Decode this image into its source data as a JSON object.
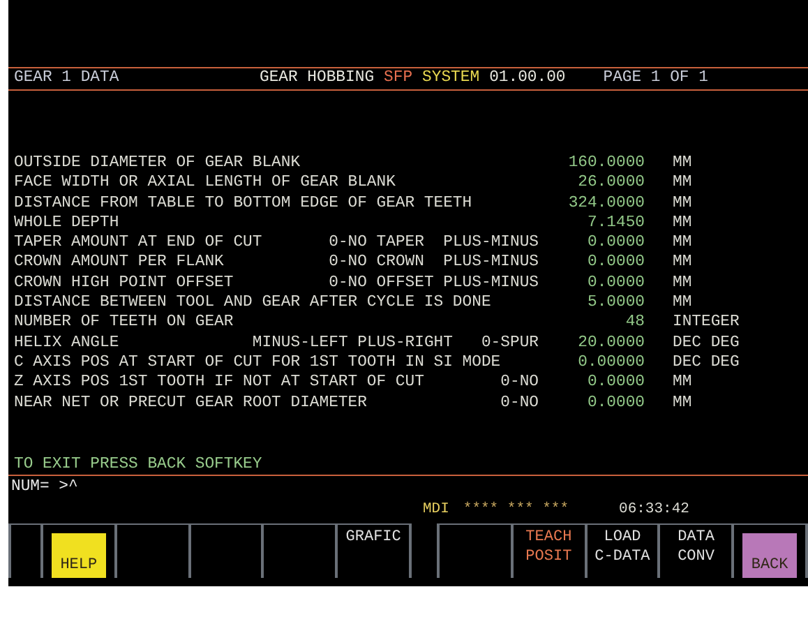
{
  "header": {
    "left": "GEAR 1 DATA",
    "system": [
      {
        "text": "GEAR HOBBING",
        "kind": "name"
      },
      {
        "text": "SFP",
        "kind": "brand"
      },
      {
        "text": "SYSTEM",
        "kind": "system"
      },
      {
        "text": "01.00.00",
        "kind": "version"
      }
    ],
    "page": "PAGE 1 OF 1"
  },
  "rows": [
    {
      "label": "OUTSIDE DIAMETER OF GEAR BLANK",
      "value": "160.0000",
      "unit": "MM"
    },
    {
      "label": "FACE WIDTH OR AXIAL LENGTH OF GEAR BLANK",
      "value": "26.0000",
      "unit": "MM"
    },
    {
      "label": "DISTANCE FROM TABLE TO BOTTOM EDGE OF GEAR TEETH",
      "value": "324.0000",
      "unit": "MM"
    },
    {
      "label": "WHOLE DEPTH",
      "value": "7.1450",
      "unit": "MM"
    },
    {
      "label": "TAPER AMOUNT AT END OF CUT",
      "option": "0-NO TAPER  PLUS-MINUS",
      "value": "0.0000",
      "unit": "MM"
    },
    {
      "label": "CROWN AMOUNT PER FLANK",
      "option": "0-NO CROWN  PLUS-MINUS",
      "value": "0.0000",
      "unit": "MM"
    },
    {
      "label": "CROWN HIGH POINT OFFSET",
      "option": "0-NO OFFSET PLUS-MINUS",
      "value": "0.0000",
      "unit": "MM"
    },
    {
      "label": "DISTANCE BETWEEN TOOL AND GEAR AFTER CYCLE IS DONE",
      "value": "5.0000",
      "unit": "MM"
    },
    {
      "label": "NUMBER OF TEETH ON GEAR",
      "value": "48",
      "unit": "INTEGER"
    },
    {
      "label": "HELIX ANGLE",
      "option": "MINUS-LEFT PLUS-RIGHT   0-SPUR",
      "value": "20.0000",
      "unit": "DEC DEG"
    },
    {
      "label": "C AXIS POS AT START OF CUT FOR 1ST TOOTH IN SI MODE",
      "value": "0.00000",
      "unit": "DEC DEG"
    },
    {
      "label": "Z AXIS POS 1ST TOOTH IF NOT AT START OF CUT",
      "option": "0-NO",
      "value": "0.0000",
      "unit": "MM"
    },
    {
      "label": "NEAR NET OR PRECUT GEAR ROOT DIAMETER",
      "option": "0-NO",
      "value": "0.0000",
      "unit": "MM"
    }
  ],
  "message": "TO EXIT PRESS BACK SOFTKEY",
  "input_line": "NUM= >^",
  "status": {
    "mode": "MDI",
    "indicators": "**** *** ***",
    "time": "06:33:42"
  },
  "softkeys": [
    {
      "kind": "blank"
    },
    {
      "kind": "filled",
      "color": "#f0e020",
      "lines": [
        "HELP"
      ]
    },
    {
      "kind": "blank"
    },
    {
      "kind": "blank"
    },
    {
      "kind": "blank"
    },
    {
      "kind": "plain",
      "lines": [
        "GRAFIC"
      ]
    },
    {
      "kind": "gap"
    },
    {
      "kind": "blank"
    },
    {
      "kind": "warning",
      "lines": [
        "TEACH",
        "POSIT"
      ]
    },
    {
      "kind": "plain",
      "lines": [
        "LOAD",
        "C-DATA"
      ]
    },
    {
      "kind": "plain",
      "lines": [
        "DATA",
        "CONV"
      ]
    },
    {
      "kind": "filled",
      "color": "#b878b8",
      "lines": [
        "BACK"
      ]
    }
  ]
}
